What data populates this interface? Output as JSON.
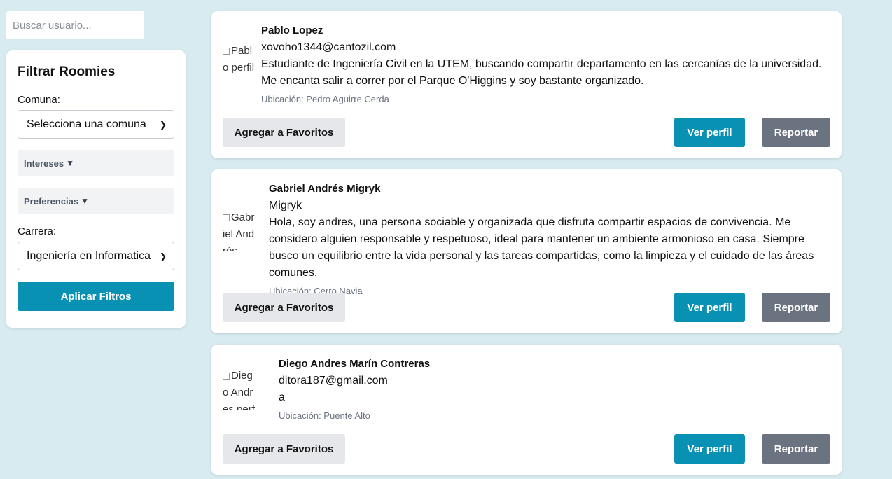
{
  "search": {
    "placeholder": "Buscar usuario..."
  },
  "filters": {
    "title": "Filtrar Roomies",
    "comuna_label": "Comuna:",
    "comuna_value": "Selecciona una comuna",
    "intereses_label": "Intereses",
    "preferencias_label": "Preferencias",
    "carrera_label": "Carrera:",
    "carrera_value": "Ingeniería en Informatica",
    "apply_label": "Aplicar Filtros"
  },
  "icons": {
    "dropdown": "chevron-down-icon",
    "expand": "triangle-down-icon",
    "broken_image": "broken-image-icon"
  },
  "colors": {
    "background": "#d8ebf1",
    "primary": "#0891b2",
    "secondary": "#6b7280",
    "neutral": "#e5e7eb"
  },
  "users": [
    {
      "avatar_alt": "Pablo perfil",
      "name": "Pablo Lopez",
      "line1": "xovoho1344@cantozil.com",
      "bio": "Estudiante de Ingeniería Civil en la UTEM, buscando compartir departamento en las cercanías de la universidad. Me encanta salir a correr por el Parque O'Higgins y soy bastante organizado.",
      "location": "Ubicación: Pedro Aguirre Cerda",
      "fav_label": "Agregar a Favoritos",
      "view_label": "Ver perfil",
      "report_label": "Reportar"
    },
    {
      "avatar_alt": "Gabriel Andrés",
      "name": "Gabriel Andrés Migryk",
      "line1": "Migryk",
      "bio": "Hola, soy andres, una persona sociable y organizada que disfruta compartir espacios de convivencia. Me considero alguien responsable y respetuoso, ideal para mantener un ambiente armonioso en casa. Siempre busco un equilibrio entre la vida personal y las tareas compartidas, como la limpieza y el cuidado de las áreas comunes.",
      "location": "Ubicación: Cerro Navia",
      "fav_label": "Agregar a Favoritos",
      "view_label": "Ver perfil",
      "report_label": "Reportar"
    },
    {
      "avatar_alt": "Diego Andres perfil",
      "name": "Diego Andres Marín Contreras",
      "line1": "ditora187@gmail.com",
      "bio": "a",
      "location": "Ubicación: Puente Alto",
      "fav_label": "Agregar a Favoritos",
      "view_label": "Ver perfil",
      "report_label": "Reportar"
    }
  ]
}
